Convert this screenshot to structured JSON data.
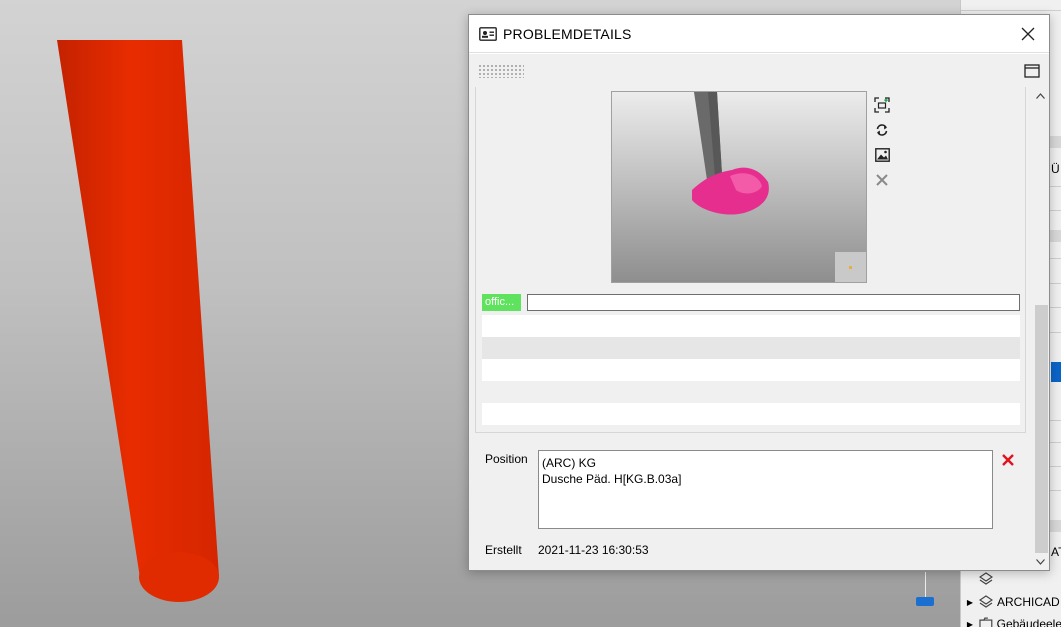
{
  "dialog": {
    "title": "PROBLEMDETAILS",
    "tag_label": "offic...",
    "tag_color": "#5fe35f",
    "tag_input_value": "",
    "position_label": "Position",
    "position_lines": [
      "(ARC) KG",
      "Dusche Päd. H[KG.B.03a]"
    ],
    "created_label": "Erstellt",
    "created_value": "2021-11-23 16:30:53",
    "image_tools": [
      "focus-camera-icon",
      "refresh-icon",
      "image-icon",
      "delete-icon"
    ]
  },
  "right_panel": {
    "glyph_top": "Ü",
    "glyph_bottom": "AT",
    "tree": [
      {
        "label": "",
        "icon": "layers-icon",
        "expander": false
      },
      {
        "label": "ARCHICAD",
        "icon": "layers-icon",
        "expander": true
      },
      {
        "label": "Gebäudeele",
        "icon": "folder-icon",
        "expander": true
      }
    ],
    "selection_color": "#0a64c8"
  },
  "viewport": {
    "pipe_color": "#e22a00",
    "model_color": "#e62e8e"
  }
}
